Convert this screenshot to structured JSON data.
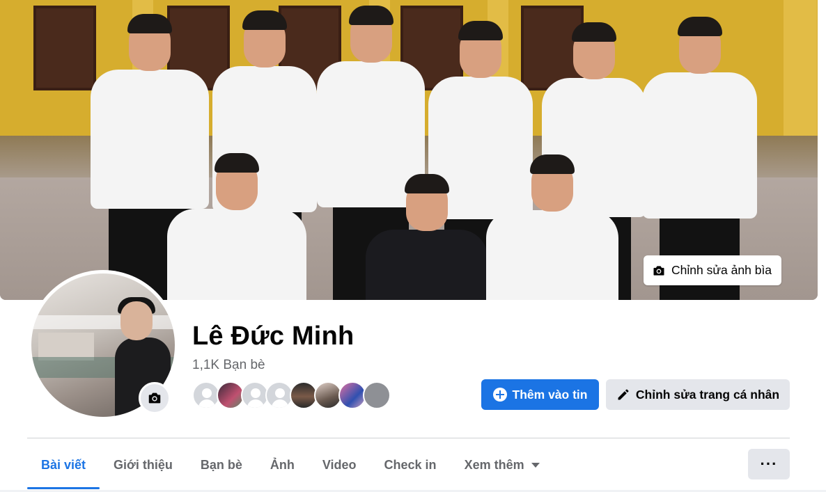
{
  "profile": {
    "name": "Lê Đức Minh",
    "friend_count": "1,1K Bạn bè"
  },
  "cover": {
    "edit_cover_label": "Chỉnh sửa ảnh bìa"
  },
  "actions": {
    "add_story_label": "Thêm vào tin",
    "edit_profile_label": "Chỉnh sửa trang cá nhân"
  },
  "tabs": [
    {
      "label": "Bài viết",
      "active": true
    },
    {
      "label": "Giới thiệu",
      "active": false
    },
    {
      "label": "Bạn bè",
      "active": false
    },
    {
      "label": "Ảnh",
      "active": false
    },
    {
      "label": "Video",
      "active": false
    },
    {
      "label": "Check in",
      "active": false
    },
    {
      "label": "Xem thêm",
      "active": false
    }
  ],
  "more_button_label": "···",
  "icons": {
    "camera": "camera-icon",
    "plus": "plus-circle-icon",
    "pencil": "pencil-icon",
    "dropdown": "caret-down-icon"
  },
  "colors": {
    "accent": "#1b74e4",
    "secondary_bg": "#e4e6eb",
    "muted_text": "#65676b"
  }
}
